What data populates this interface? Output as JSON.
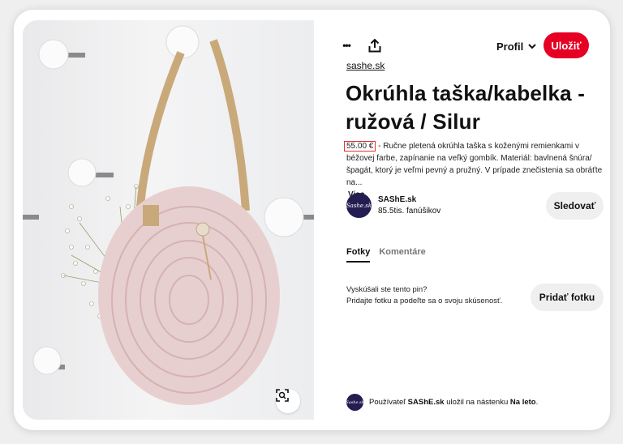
{
  "header": {
    "more_label": "•••",
    "profile_label": "Profil",
    "save_label": "Uložiť"
  },
  "pin": {
    "source": "sashe.sk",
    "title": "Okrúhla taška/kabelka - ružová / Silur",
    "price": "55.00 €",
    "description": "- Ručne pletená okrúhla taška s koženými remienkami v béžovej farbe, zapínanie na veľký gombík. Materiál: bavlnená šnúra/špagát, ktorý je veľmi pevný a pružný. V prípade znečistenia sa obráťte na...",
    "more_label": "Viac"
  },
  "author": {
    "avatar_text": "Sashe.sk",
    "name": "SAShE.sk",
    "followers": "85.5tis. fanúšikov",
    "follow_label": "Sledovať"
  },
  "tabs": [
    {
      "label": "Fotky",
      "active": true
    },
    {
      "label": "Komentáre",
      "active": false
    }
  ],
  "tried": {
    "line1": "Vyskúšali ste tento pin?",
    "line2": "Pridajte fotku a podeľte sa o svoju skúsenosť.",
    "button_label": "Pridať fotku"
  },
  "footer": {
    "prefix": "Používateľ",
    "user": "SAShE.sk",
    "middle": "uložil na nástenku",
    "board": "Na leto",
    "suffix": "."
  },
  "colors": {
    "accent": "#e60023",
    "price_highlight": "#e0302e",
    "avatar_bg": "#241d52"
  },
  "icons": [
    "more-dots-icon",
    "share-upload-icon",
    "chevron-down-icon",
    "visual-search-icon"
  ]
}
